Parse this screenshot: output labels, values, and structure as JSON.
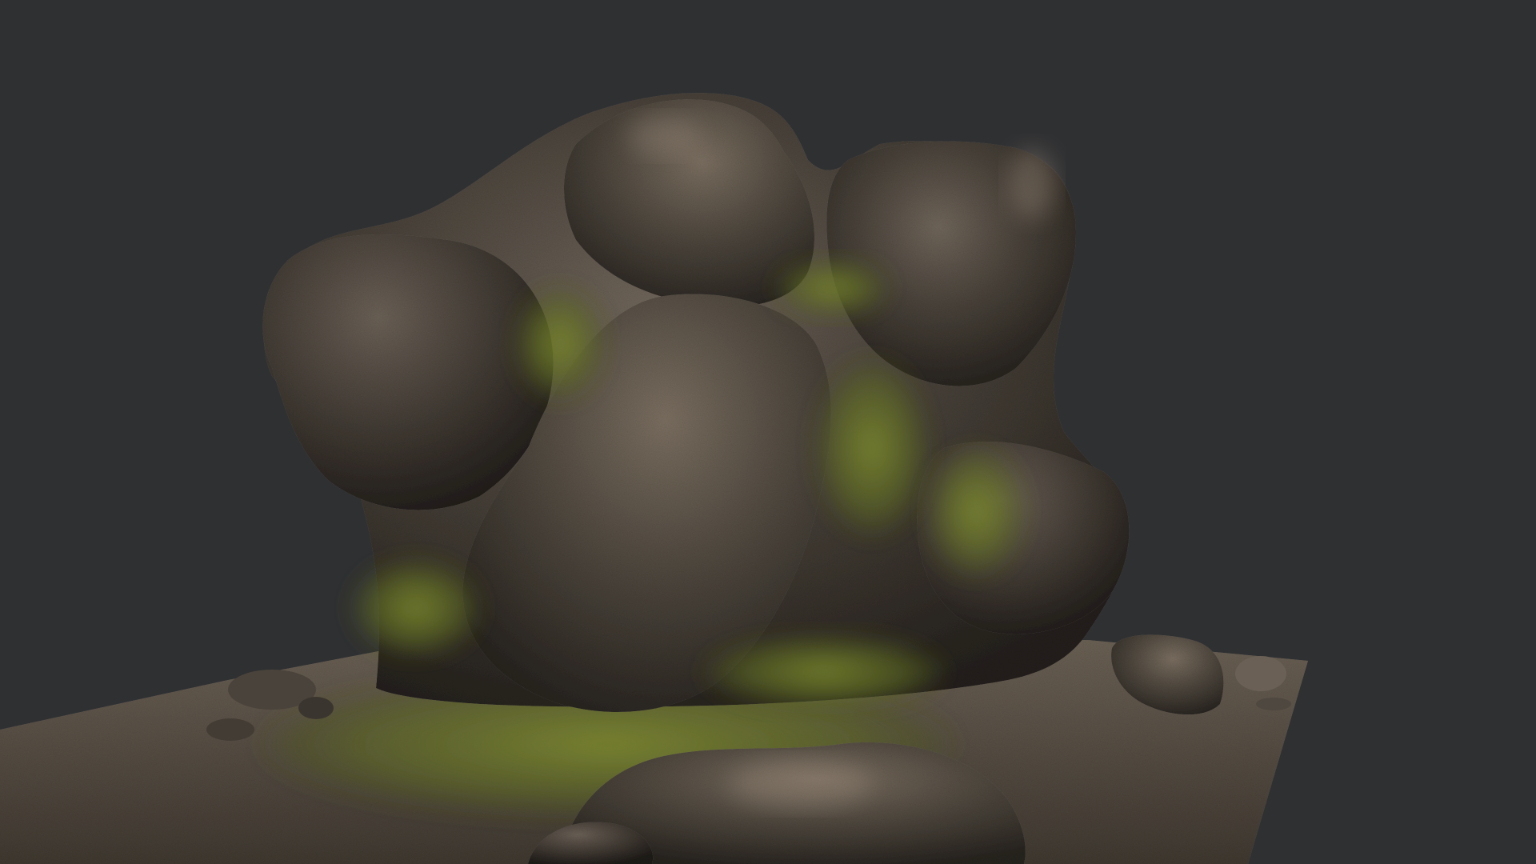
{
  "viewport": {
    "background_color": "#2f3032",
    "subject": "mossy-rock-3d-model",
    "colors": {
      "rock_dark": "#2a2622",
      "rock_mid": "#4a433b",
      "rock_light": "#7a6e60",
      "moss": "#5e6a22",
      "moss_light": "#7d8a2e",
      "ground": "#5a5046",
      "ground_light": "#7b6f62"
    }
  }
}
